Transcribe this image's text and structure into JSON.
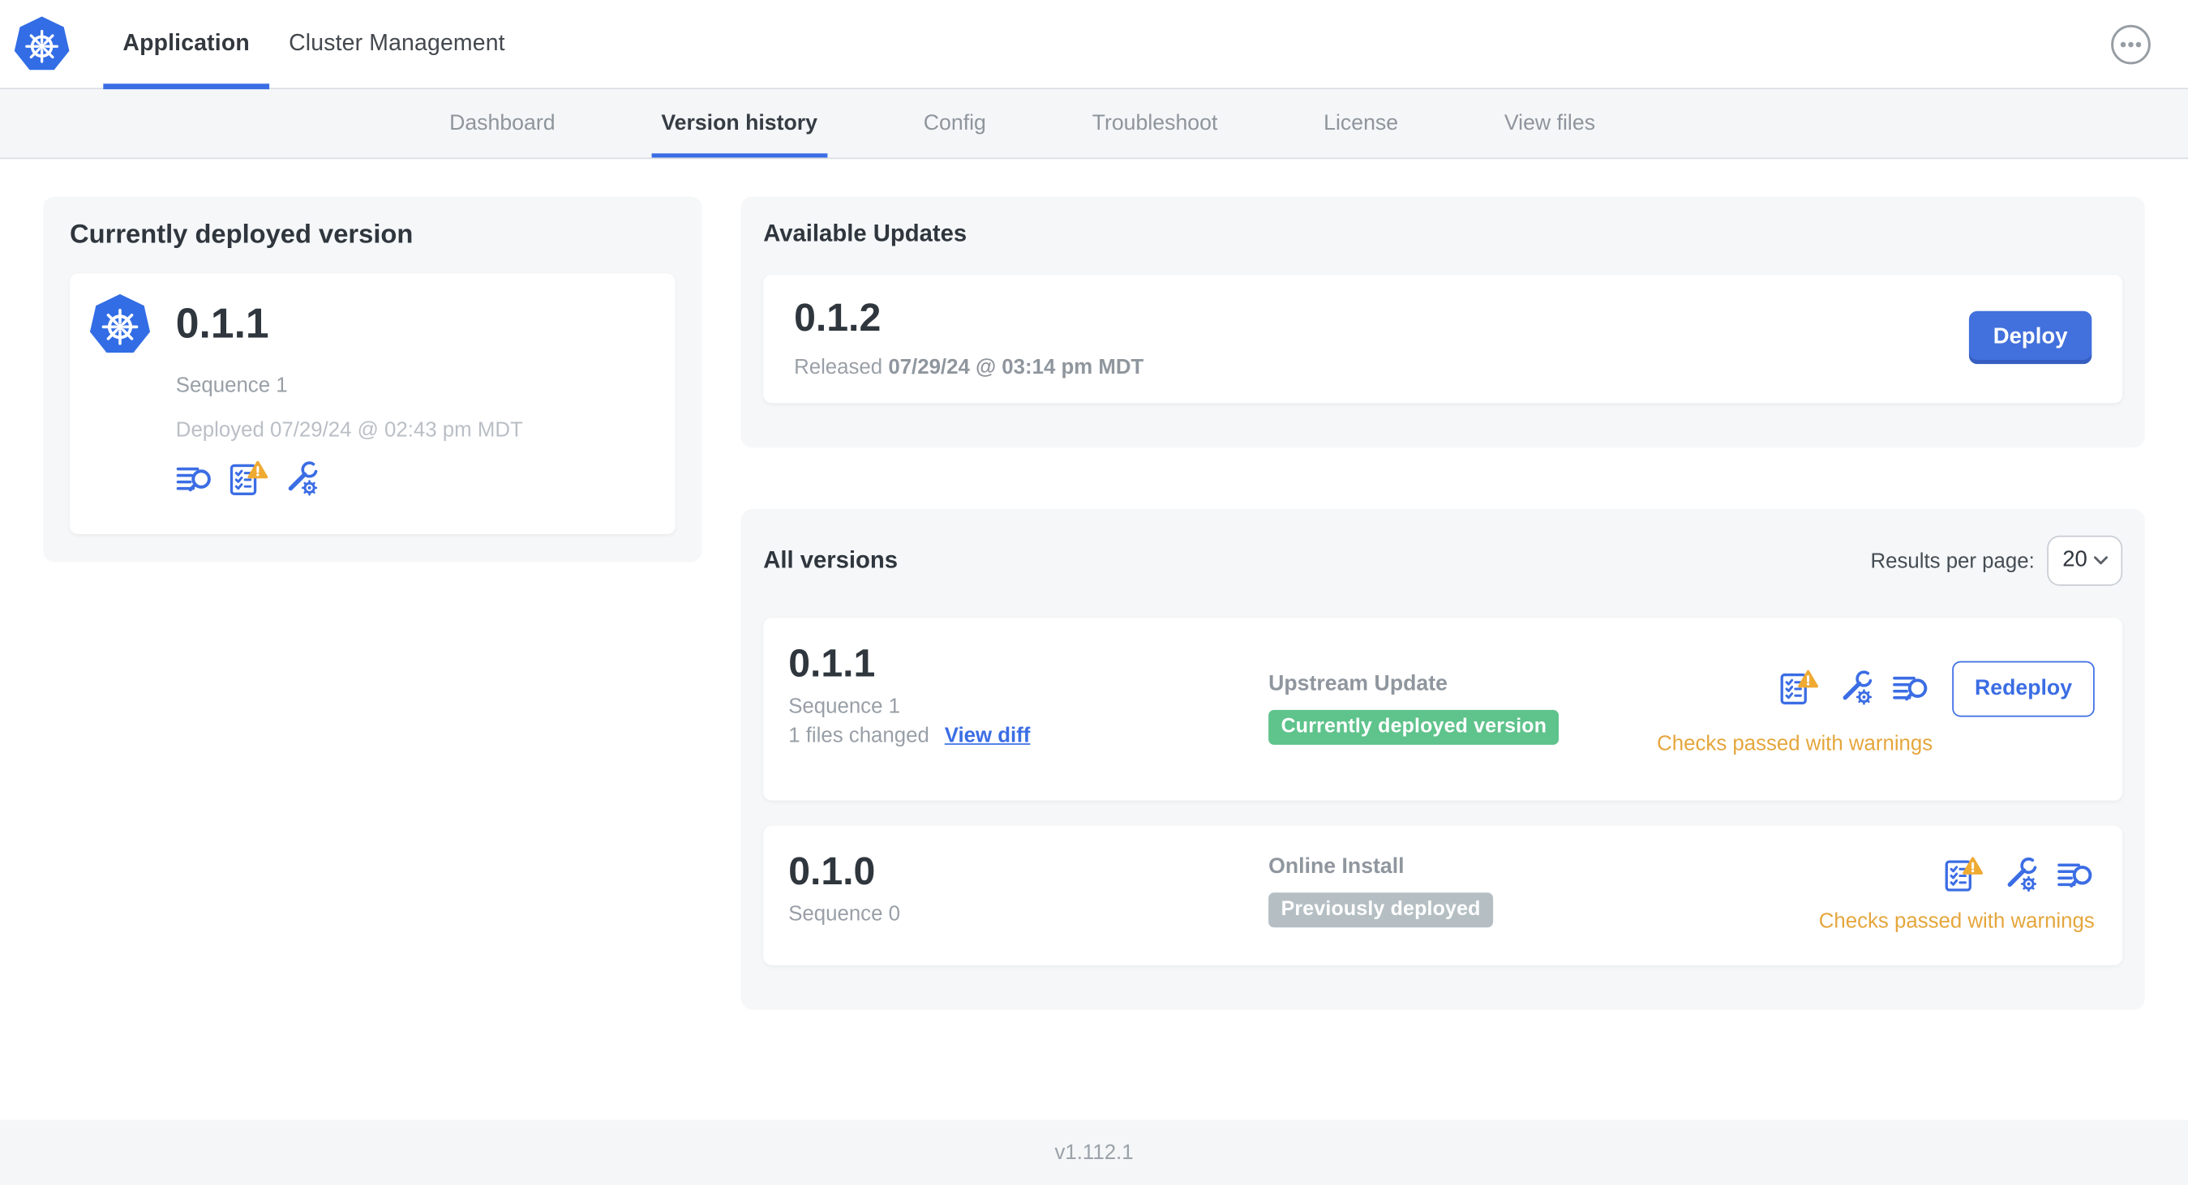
{
  "colors": {
    "primary_blue": "#3b6de4",
    "k8s_blue": "#326de6",
    "deploy_button_blue": "#4270dc",
    "warning_text": "#e5a63c",
    "warning_triangle": "#efaa32",
    "badge_green": "#5fc38c",
    "badge_gray": "#b5bfc3"
  },
  "header": {
    "tabs": [
      {
        "label": "Application"
      },
      {
        "label": "Cluster Management"
      }
    ]
  },
  "subnav": {
    "tabs": [
      "Dashboard",
      "Version history",
      "Config",
      "Troubleshoot",
      "License",
      "View files"
    ]
  },
  "deployed_card": {
    "title": "Currently deployed version",
    "version": "0.1.1",
    "sequence": "Sequence 1",
    "deployed_at": "Deployed 07/29/24 @ 02:43 pm MDT"
  },
  "available_updates": {
    "title": "Available Updates",
    "version": "0.1.2",
    "released_label": "Released",
    "released_at": "07/29/24 @ 03:14 pm MDT",
    "deploy_label": "Deploy"
  },
  "all_versions": {
    "title": "All versions",
    "results_per_page_label": "Results per page:",
    "results_per_page_value": "20",
    "rows": [
      {
        "version": "0.1.1",
        "sequence": "Sequence 1",
        "files_changed": "1 files changed",
        "view_diff_label": "View diff",
        "source_type": "Upstream Update",
        "badge_label": "Currently deployed version",
        "badge_color": "#5fc38c",
        "status_text": "Checks passed with warnings",
        "action_label": "Redeploy"
      },
      {
        "version": "0.1.0",
        "sequence": "Sequence 0",
        "source_type": "Online Install",
        "badge_label": "Previously deployed",
        "badge_color": "#b5bfc3",
        "status_text": "Checks passed with warnings"
      }
    ]
  },
  "footer": {
    "app_version": "v1.112.1"
  }
}
